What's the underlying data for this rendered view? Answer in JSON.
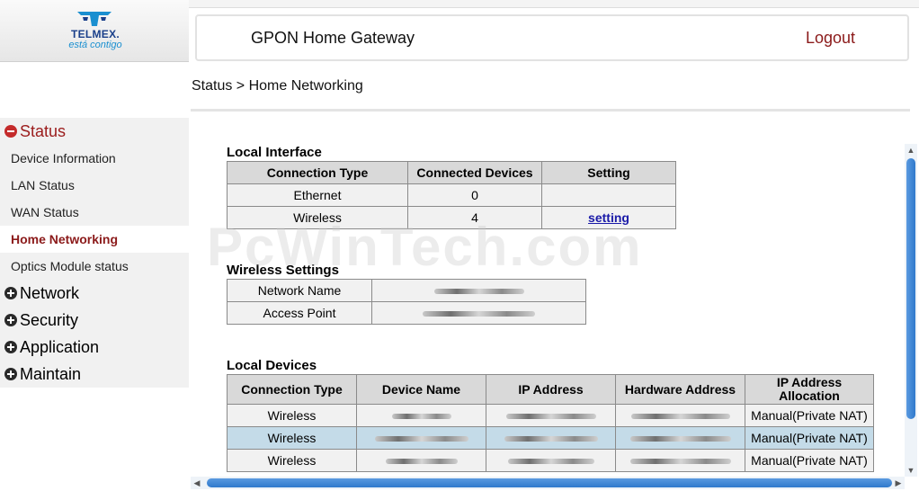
{
  "brand": {
    "name": "TELMEX.",
    "tagline": "está contigo"
  },
  "header": {
    "title": "GPON Home Gateway",
    "logout_label": "Logout"
  },
  "breadcrumb": "Status > Home Networking",
  "watermark": "PcWinTech.com",
  "sidebar": {
    "categories": [
      {
        "label": "Status",
        "state": "expanded",
        "items": [
          "Device Information",
          "LAN Status",
          "WAN Status",
          "Home Networking",
          "Optics Module status"
        ],
        "active_item": "Home Networking"
      },
      {
        "label": "Network",
        "state": "collapsed"
      },
      {
        "label": "Security",
        "state": "collapsed"
      },
      {
        "label": "Application",
        "state": "collapsed"
      },
      {
        "label": "Maintain",
        "state": "collapsed"
      }
    ]
  },
  "local_interface": {
    "title": "Local Interface",
    "headers": [
      "Connection Type",
      "Connected Devices",
      "Setting"
    ],
    "rows": [
      {
        "type": "Ethernet",
        "devices": "0",
        "setting": ""
      },
      {
        "type": "Wireless",
        "devices": "4",
        "setting": "setting"
      }
    ]
  },
  "wireless_settings": {
    "title": "Wireless Settings",
    "rows": [
      {
        "label": "Network Name",
        "value_redacted": true
      },
      {
        "label": "Access Point",
        "value_redacted": true
      }
    ]
  },
  "local_devices": {
    "title": "Local Devices",
    "headers": [
      "Connection Type",
      "Device Name",
      "IP Address",
      "Hardware Address",
      "IP Address Allocation"
    ],
    "rows": [
      {
        "type": "Wireless",
        "allocation": "Manual(Private NAT)",
        "selected": false
      },
      {
        "type": "Wireless",
        "allocation": "Manual(Private NAT)",
        "selected": true
      },
      {
        "type": "Wireless",
        "allocation": "Manual(Private NAT)",
        "selected": false
      }
    ]
  },
  "colors": {
    "accent": "#8b1a1a",
    "link": "#1a1aa8",
    "scroll_thumb": "#2f79cc",
    "selected_row": "#c4dbe8"
  }
}
